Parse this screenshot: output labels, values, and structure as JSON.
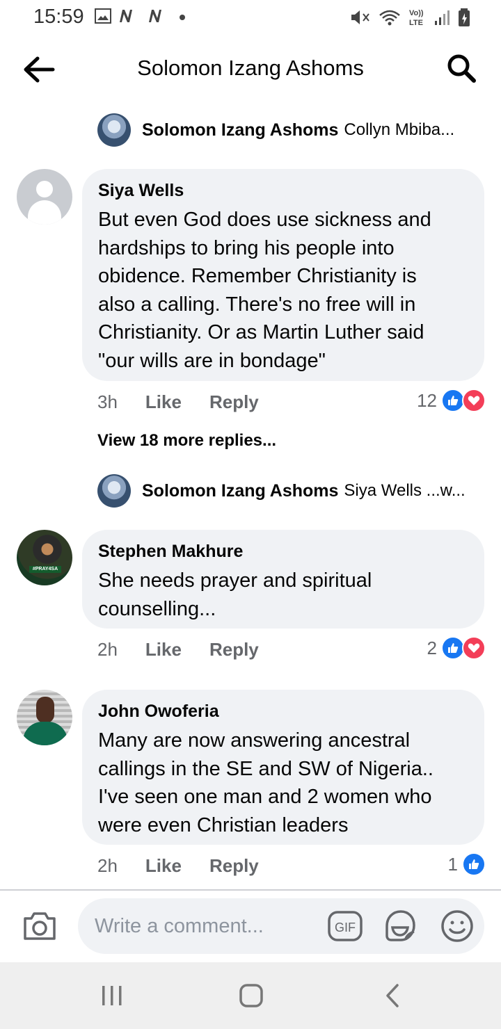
{
  "status_bar": {
    "time": "15:59"
  },
  "header": {
    "title": "Solomon Izang Ashoms"
  },
  "thread": {
    "reply_previews": [
      {
        "name": "Solomon Izang Ashoms",
        "text": "Collyn Mbiba..."
      },
      {
        "name": "Solomon Izang Ashoms",
        "text": "Siya Wells ...w..."
      }
    ],
    "comments": [
      {
        "author": "Siya Wells",
        "lines": [
          "But even God does use sickness and",
          "hardships to bring his people into",
          "obidence. Remember Christianity is",
          "also a calling. There's no free will in",
          "Christianity. Or as Martin Luther said",
          "\"our wills are in bondage\""
        ],
        "time": "3h",
        "like_label": "Like",
        "reply_label": "Reply",
        "reaction_count": "12",
        "reactions": [
          "like",
          "love"
        ]
      },
      {
        "author": "Stephen Makhure",
        "avatar_tag": "#PRAY4SA",
        "lines": [
          "She needs prayer and spiritual",
          "counselling..."
        ],
        "time": "2h",
        "like_label": "Like",
        "reply_label": "Reply",
        "reaction_count": "2",
        "reactions": [
          "like",
          "love"
        ]
      },
      {
        "author": "John Owoferia",
        "lines": [
          "Many are now answering ancestral",
          "callings in the SE and SW of Nigeria..",
          "I've seen one man and 2 women who",
          "were even Christian leaders"
        ],
        "time": "2h",
        "like_label": "Like",
        "reply_label": "Reply",
        "reaction_count": "1",
        "reactions": [
          "like"
        ]
      }
    ],
    "view_more": "View 18 more replies..."
  },
  "composer": {
    "placeholder": "Write a comment...",
    "gif_label": "GIF"
  },
  "icons": {
    "back": "arrow-left-icon",
    "search": "search-icon",
    "camera": "camera-icon",
    "gif": "gif-icon",
    "sticker": "sticker-icon",
    "emoji": "emoji-icon"
  },
  "colors": {
    "facebook_blue": "#1877f2",
    "love_red": "#f33e58",
    "bubble_gray": "#f0f2f5",
    "secondary_text": "#65676b"
  }
}
